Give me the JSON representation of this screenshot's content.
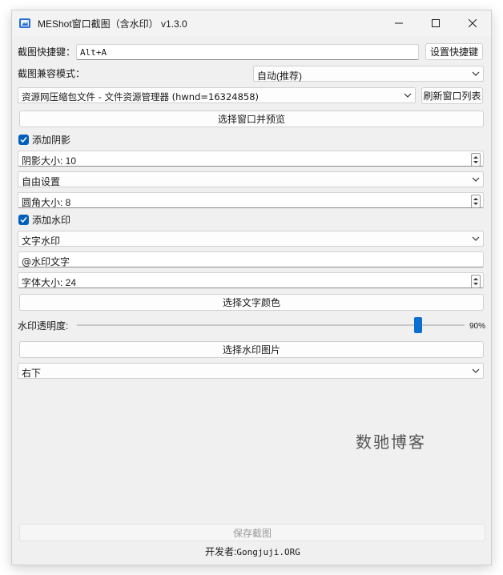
{
  "window": {
    "title": "MEShot窗口截图（含水印） v1.3.0",
    "accent": "#005fb8"
  },
  "hotkey": {
    "label": "截图快捷键：",
    "value": "Alt+A",
    "set_button": "设置快捷键"
  },
  "compat": {
    "label": "截图兼容模式：",
    "selected": "自动(推荐)"
  },
  "window_select": {
    "selected": "资源网压缩包文件 - 文件资源管理器 (hwnd=16324858)",
    "refresh_button": "刷新窗口列表",
    "preview_button": "选择窗口并预览"
  },
  "shadow": {
    "checkbox_label": "添加阴影",
    "checked": true,
    "size_text": "阴影大小: 10",
    "mode": "自由设置",
    "radius_text": "圆角大小: 8"
  },
  "watermark": {
    "checkbox_label": "添加水印",
    "checked": true,
    "type": "文字水印",
    "text_value": "@水印文字",
    "font_size_text": "字体大小: 24",
    "color_button": "选择文字颜色",
    "opacity_label": "水印透明度:",
    "opacity_value": "90%",
    "opacity_fraction": 0.9,
    "image_button": "选择水印图片",
    "position": "右下",
    "preview_text": "数驰博客"
  },
  "footer": {
    "save_button": "保存截图",
    "developer_label": "开发者:",
    "developer_name": "Gongjuji.ORG"
  }
}
